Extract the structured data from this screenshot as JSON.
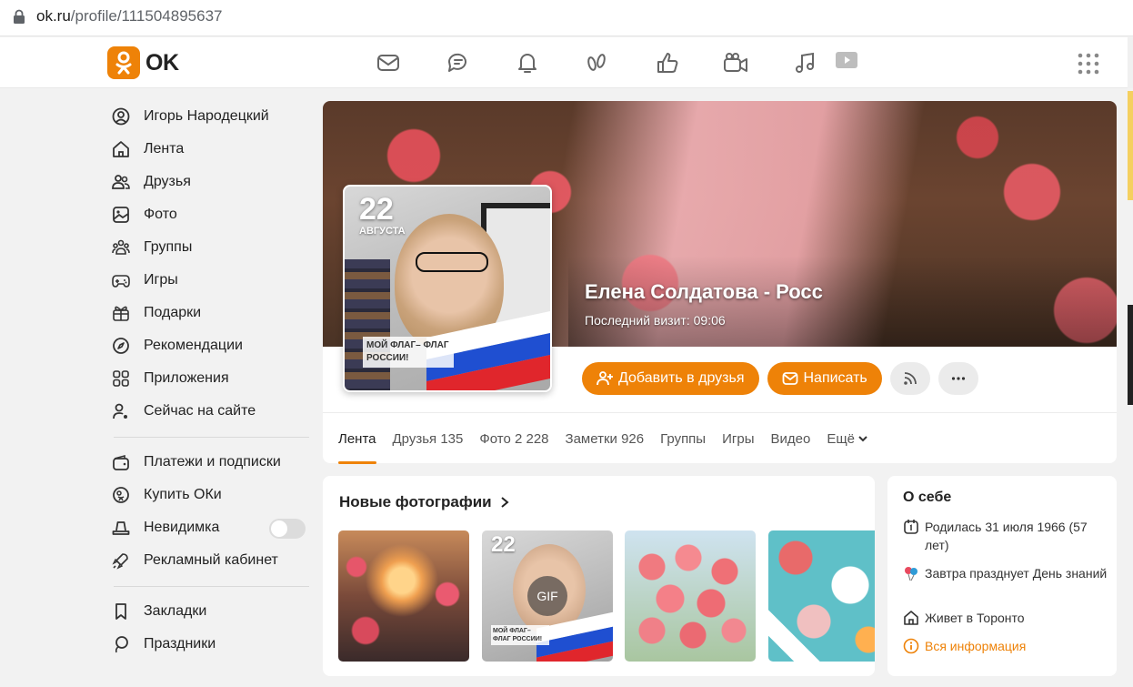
{
  "browser": {
    "url_host": "ok.ru",
    "url_path": "/profile/111504895637"
  },
  "header": {
    "logo_text": "OK",
    "accent": "#ee8208",
    "nav_icons": [
      "messages-icon",
      "discussions-icon",
      "notifications-icon",
      "guests-icon",
      "events-icon",
      "video-icon",
      "music-icon",
      "video-player-icon"
    ]
  },
  "sidebar": {
    "items": [
      {
        "label": "Игорь Народецкий",
        "icon": "user-icon"
      },
      {
        "label": "Лента",
        "icon": "home-icon"
      },
      {
        "label": "Друзья",
        "icon": "friends-icon"
      },
      {
        "label": "Фото",
        "icon": "photo-icon"
      },
      {
        "label": "Группы",
        "icon": "groups-icon"
      },
      {
        "label": "Игры",
        "icon": "gamepad-icon"
      },
      {
        "label": "Подарки",
        "icon": "gift-icon"
      },
      {
        "label": "Рекомендации",
        "icon": "compass-icon"
      },
      {
        "label": "Приложения",
        "icon": "apps-grid-icon"
      },
      {
        "label": "Сейчас на сайте",
        "icon": "online-user-icon"
      }
    ],
    "items2": [
      {
        "label": "Платежи и подписки",
        "icon": "wallet-icon"
      },
      {
        "label": "Купить ОКи",
        "icon": "coin-icon"
      },
      {
        "label": "Невидимка",
        "icon": "hat-icon",
        "toggle": false
      },
      {
        "label": "Рекламный кабинет",
        "icon": "rocket-icon"
      }
    ],
    "items3": [
      {
        "label": "Закладки",
        "icon": "bookmark-icon"
      },
      {
        "label": "Праздники",
        "icon": "balloon-icon"
      }
    ]
  },
  "profile": {
    "name": "Елена Солдатова - Росс",
    "last_visit": "Последний визит: 09:06",
    "avatar_date_num": "22",
    "avatar_date_month": "АВГУСТА",
    "avatar_badge": "МОЙ ФЛАГ– ФЛАГ РОССИИ!",
    "add_friend": "Добавить в друзья",
    "write": "Написать"
  },
  "tabs": [
    {
      "label": "Лента",
      "active": true
    },
    {
      "label": "Друзья 135"
    },
    {
      "label": "Фото 2 228"
    },
    {
      "label": "Заметки 926"
    },
    {
      "label": "Группы"
    },
    {
      "label": "Игры"
    },
    {
      "label": "Видео"
    },
    {
      "label": "Ещё"
    }
  ],
  "photos": {
    "title": "Новые фотографии",
    "thumb2_num": "22",
    "thumb2_gif": "GIF",
    "thumb2_badge": "МОЙ ФЛАГ– ФЛАГ РОССИИ!"
  },
  "about": {
    "title": "О себе",
    "born": "Родилась 31 июля 1966 (57 лет)",
    "holiday": "Завтра празднует День знаний",
    "lives": "Живет в Торонто",
    "all_info": "Вся информация"
  }
}
